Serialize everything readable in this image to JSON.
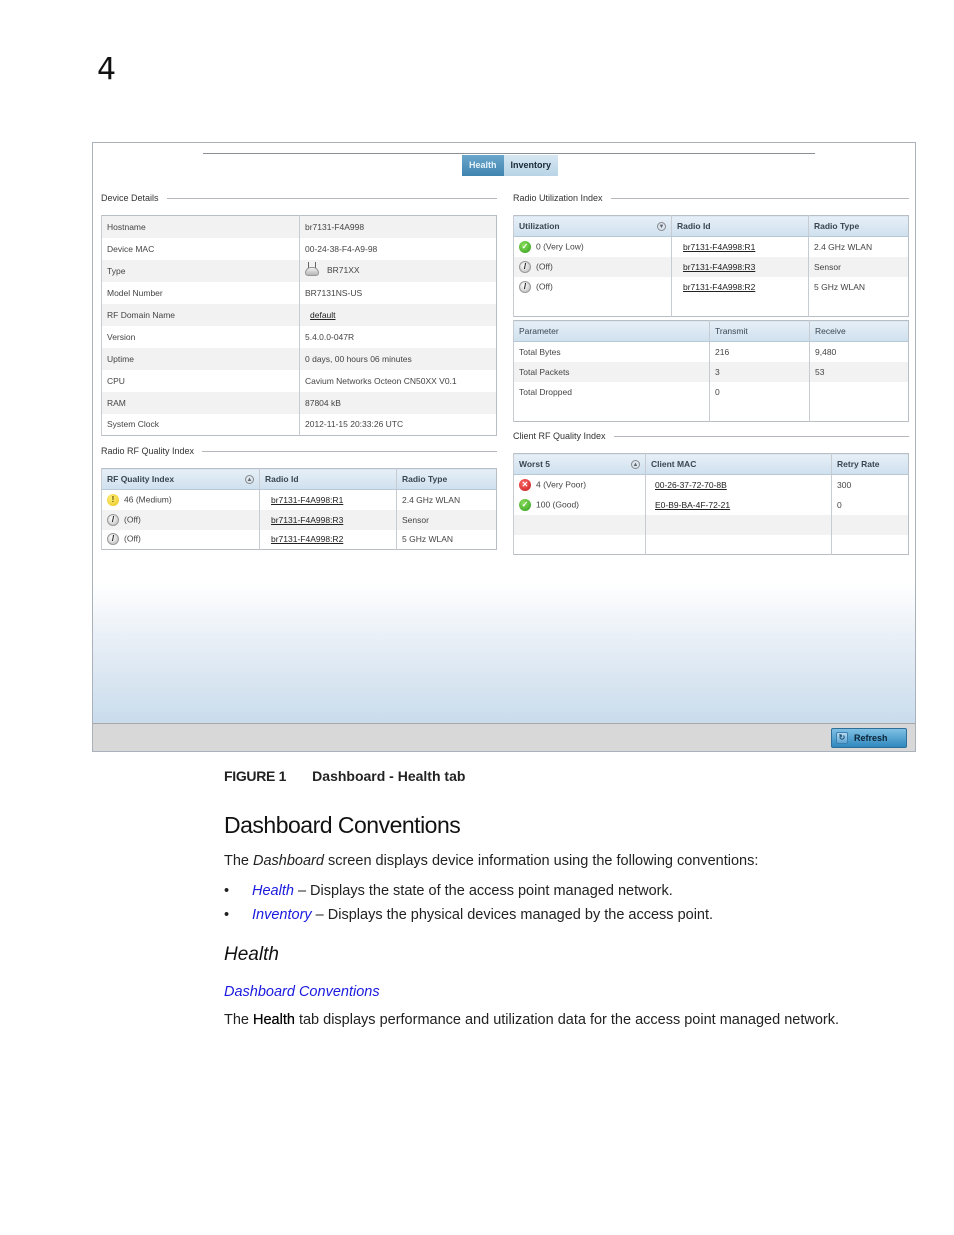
{
  "page": {
    "chapter_number": "4"
  },
  "screenshot": {
    "tabs": [
      {
        "label": "Health",
        "active": true
      },
      {
        "label": "Inventory",
        "active": false
      }
    ],
    "device_details": {
      "title": "Device Details",
      "rows": [
        {
          "label": "Hostname",
          "value": "br7131-F4A998"
        },
        {
          "label": "Device MAC",
          "value": "00-24-38-F4-A9-98"
        },
        {
          "label": "Type",
          "value": "BR71XX",
          "icon": "access-point-icon"
        },
        {
          "label": "Model Number",
          "value": "BR7131NS-US"
        },
        {
          "label": "RF Domain Name",
          "value": "default",
          "link": true
        },
        {
          "label": "Version",
          "value": "5.4.0.0-047R"
        },
        {
          "label": "Uptime",
          "value": "0 days, 00 hours 06 minutes"
        },
        {
          "label": "CPU",
          "value": "Cavium Networks Octeon CN50XX V0.1"
        },
        {
          "label": "RAM",
          "value": "87804 kB"
        },
        {
          "label": "System Clock",
          "value": "2012-11-15 20:33:26 UTC"
        }
      ]
    },
    "radio_rf_quality": {
      "title": "Radio RF Quality Index",
      "headers": [
        "RF Quality Index",
        "Radio Id",
        "Radio Type"
      ],
      "sort_icon": "sort-up-icon",
      "rows": [
        {
          "status": "warning",
          "value": "46 (Medium)",
          "radio_id": "br7131-F4A998:R1",
          "radio_type": "2.4 GHz WLAN"
        },
        {
          "status": "off",
          "value": "(Off)",
          "radio_id": "br7131-F4A998:R3",
          "radio_type": "Sensor"
        },
        {
          "status": "off",
          "value": "(Off)",
          "radio_id": "br7131-F4A998:R2",
          "radio_type": "5 GHz WLAN"
        }
      ]
    },
    "radio_utilization": {
      "title": "Radio Utilization Index",
      "headers": [
        "Utilization",
        "Radio Id",
        "Radio Type"
      ],
      "sort_icon": "sort-down-icon",
      "rows": [
        {
          "status": "ok",
          "value": "0 (Very Low)",
          "radio_id": "br7131-F4A998:R1",
          "radio_type": "2.4 GHz WLAN"
        },
        {
          "status": "off",
          "value": "(Off)",
          "radio_id": "br7131-F4A998:R3",
          "radio_type": "Sensor"
        },
        {
          "status": "off",
          "value": "(Off)",
          "radio_id": "br7131-F4A998:R2",
          "radio_type": "5 GHz WLAN"
        }
      ]
    },
    "traffic": {
      "headers": [
        "Parameter",
        "Transmit",
        "Receive"
      ],
      "rows": [
        {
          "parameter": "Total Bytes",
          "transmit": "216",
          "receive": "9,480"
        },
        {
          "parameter": "Total Packets",
          "transmit": "3",
          "receive": "53"
        },
        {
          "parameter": "Total Dropped",
          "transmit": "0",
          "receive": ""
        }
      ]
    },
    "client_rf_quality": {
      "title": "Client RF Quality Index",
      "headers": [
        "Worst 5",
        "Client MAC",
        "Retry Rate"
      ],
      "sort_icon": "sort-up-icon",
      "rows": [
        {
          "status": "bad",
          "value": "4 (Very Poor)",
          "mac": "00-26-37-72-70-8B",
          "retry": "300"
        },
        {
          "status": "ok",
          "value": "100 (Good)",
          "mac": "E0-B9-BA-4F-72-21",
          "retry": "0"
        }
      ]
    },
    "refresh_label": "Refresh"
  },
  "caption": {
    "label": "FIGURE 1",
    "title": "Dashboard - Health tab"
  },
  "section": {
    "heading": "Dashboard Conventions",
    "intro_pre": "The ",
    "intro_em": "Dashboard",
    "intro_post": " screen displays device information using the following conventions:",
    "bullets": [
      {
        "link": "Health",
        "text": " – Displays the state of the access point managed network."
      },
      {
        "link": "Inventory",
        "text": " – Displays the physical devices managed by the access point."
      }
    ]
  },
  "subsection": {
    "heading": "Health",
    "back_link": "Dashboard Conventions",
    "body_pre": "The ",
    "body_bold": "Health",
    "body_post": " tab displays performance and utilization data for the access point managed network."
  },
  "colors": {
    "accent_tab": "#3f84b0",
    "link_blue": "#1a1adf",
    "status_ok": "#2f9a1d",
    "status_bad": "#c21818",
    "status_warn": "#e8c21a"
  }
}
